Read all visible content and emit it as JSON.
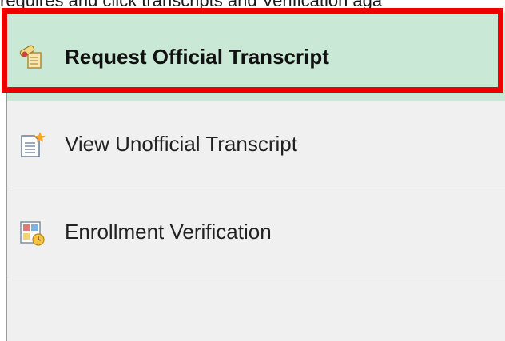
{
  "caption": {
    "text": "requires and click transcripts and Verification aga"
  },
  "menu": {
    "items": [
      {
        "label": "Request Official Transcript",
        "icon": "diploma-icon",
        "selected": true
      },
      {
        "label": "View Unofficial Transcript",
        "icon": "document-star-icon",
        "selected": false
      },
      {
        "label": "Enrollment Verification",
        "icon": "verification-clock-icon",
        "selected": false
      }
    ]
  },
  "colors": {
    "selected_background": "#c9e8d6",
    "highlight_border": "#ee0000",
    "panel_background": "#f0f0f0"
  }
}
